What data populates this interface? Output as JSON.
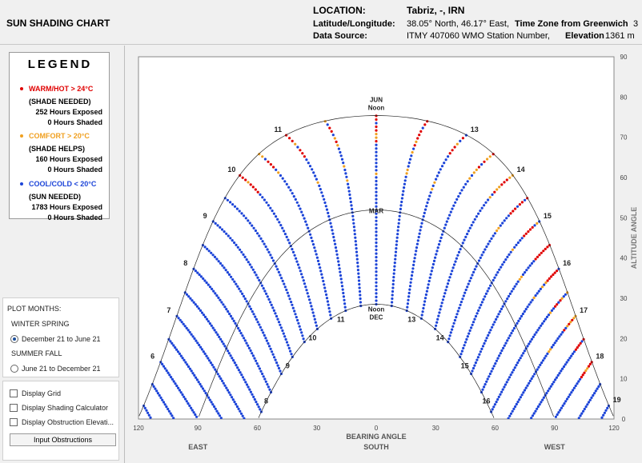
{
  "header": {
    "app_title": "SUN SHADING CHART",
    "location_label": "LOCATION:",
    "location_value": "Tabriz, -, IRN",
    "latlon_label": "Latitude/Longitude:",
    "latlon_value": "38.05° North, 46.17° East,",
    "timezone_label": "Time Zone from Greenwich",
    "timezone_value": "3",
    "source_label": "Data Source:",
    "source_value": "ITMY    407060 WMO Station Number,",
    "elevation_label": "Elevation",
    "elevation_value": "1361 m"
  },
  "legend": {
    "title": "LEGEND",
    "warm_label": "WARM/HOT  > 24°C",
    "warm_desc": "(SHADE NEEDED)",
    "warm_exposed": "252 Hours Exposed",
    "warm_shaded": "0 Hours Shaded",
    "comfort_label": "COMFORT  > 20°C",
    "comfort_desc": "(SHADE HELPS)",
    "comfort_exposed": "160 Hours Exposed",
    "comfort_shaded": "0 Hours Shaded",
    "cool_label": "COOL/COLD  < 20°C",
    "cool_desc": "(SUN NEEDED)",
    "cool_exposed": "1783 Hours Exposed",
    "cool_shaded": "0 Hours Shaded",
    "colors": {
      "warm": "#e00000",
      "comfort": "#f0a020",
      "cool": "#1c44d8"
    }
  },
  "plot_months": {
    "title": "PLOT MONTHS:",
    "winter_spring": "WINTER SPRING",
    "option1": "December 21 to June 21",
    "summer_fall": "SUMMER FALL",
    "option2": "June 21 to December 21",
    "selected": "December 21 to June 21"
  },
  "options": {
    "display_grid": "Display Grid",
    "display_shading": "Display Shading Calculator",
    "display_obstruction": "Display Obstruction Elevati...",
    "input_obstructions": "Input Obstructions"
  },
  "chart_data": {
    "type": "scatter",
    "xlabel": "BEARING ANGLE",
    "ylabel": "ALTITUDE ANGLE",
    "xlim": [
      -120,
      120
    ],
    "ylim": [
      0,
      90
    ],
    "x_ticks": [
      "120",
      "90",
      "60",
      "30",
      "0",
      "30",
      "60",
      "90",
      "120"
    ],
    "y_ticks": [
      "0",
      "10",
      "20",
      "30",
      "40",
      "50",
      "60",
      "70",
      "80",
      "90"
    ],
    "direction_labels": [
      "EAST",
      "SOUTH",
      "WEST"
    ],
    "grid": false,
    "latitude": 38.05,
    "declination_labels": {
      "jun": "JUN",
      "mar": "MAR",
      "dec": "DEC",
      "noon": "Noon"
    },
    "hour_labels_summer": [
      "6",
      "7",
      "8",
      "9",
      "10",
      "11",
      "13",
      "14",
      "15",
      "16",
      "17",
      "18",
      "19"
    ],
    "hour_labels_winter": [
      "8",
      "9",
      "10",
      "11",
      "13",
      "14",
      "15",
      "16"
    ]
  }
}
